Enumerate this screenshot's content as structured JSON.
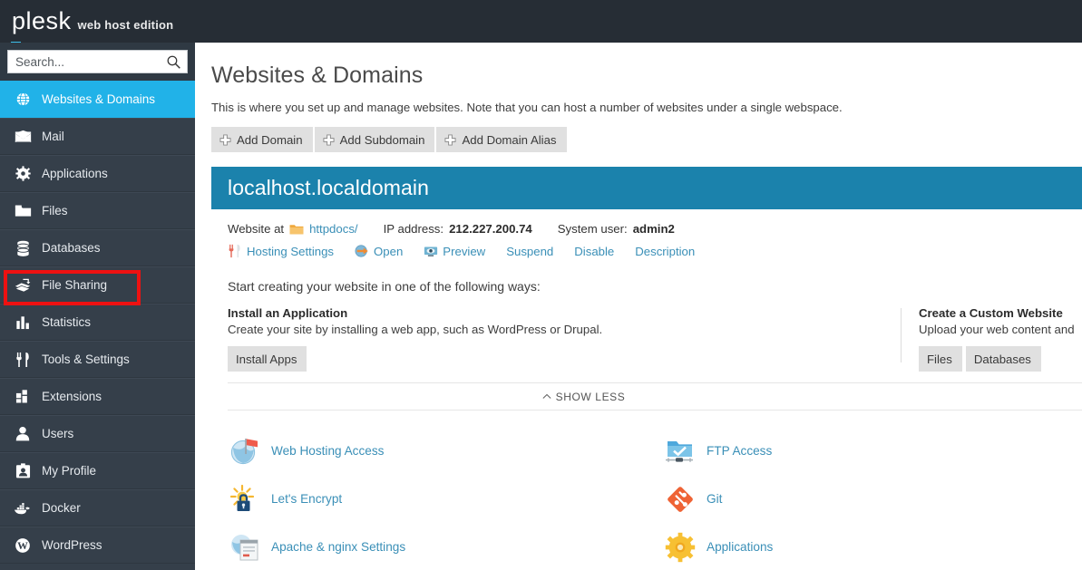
{
  "brand": {
    "name": "plesk",
    "edition": "web host edition"
  },
  "search": {
    "placeholder": "Search...",
    "value": "",
    "icon": "search-icon"
  },
  "sidebar": {
    "items": [
      {
        "label": "Websites & Domains",
        "icon": "globe-icon",
        "active": true
      },
      {
        "label": "Mail",
        "icon": "envelope-icon",
        "active": false
      },
      {
        "label": "Applications",
        "icon": "gear-icon",
        "active": false
      },
      {
        "label": "Files",
        "icon": "folder-icon",
        "active": false
      },
      {
        "label": "Databases",
        "icon": "database-icon",
        "active": false
      },
      {
        "label": "File Sharing",
        "icon": "file-sharing-icon",
        "active": false,
        "highlighted": true
      },
      {
        "label": "Statistics",
        "icon": "bar-chart-icon",
        "active": false
      },
      {
        "label": "Tools & Settings",
        "icon": "fork-knife-icon",
        "active": false
      },
      {
        "label": "Extensions",
        "icon": "blocks-icon",
        "active": false
      },
      {
        "label": "Users",
        "icon": "user-icon",
        "active": false
      },
      {
        "label": "My Profile",
        "icon": "id-card-icon",
        "active": false
      },
      {
        "label": "Docker",
        "icon": "docker-whale-icon",
        "active": false
      },
      {
        "label": "WordPress",
        "icon": "wordpress-icon",
        "active": false
      }
    ]
  },
  "main": {
    "title": "Websites & Domains",
    "description": "This is where you set up and manage websites. Note that you can host a number of websites under a single webspace.",
    "buttons": [
      {
        "label": "Add Domain",
        "icon": "plus-icon"
      },
      {
        "label": "Add Subdomain",
        "icon": "plus-icon"
      },
      {
        "label": "Add Domain Alias",
        "icon": "plus-icon"
      }
    ]
  },
  "domain": {
    "name": "localhost.localdomain",
    "website_at_label": "Website at",
    "docroot": "httpdocs/",
    "ip_label": "IP address:",
    "ip_value": "212.227.200.74",
    "user_label": "System user:",
    "user_value": "admin2",
    "actions": [
      {
        "label": "Hosting Settings",
        "icon": "fork-knife-icon"
      },
      {
        "label": "Open",
        "icon": "open-arrow-icon"
      },
      {
        "label": "Preview",
        "icon": "preview-eye-icon"
      },
      {
        "label": "Suspend",
        "icon": ""
      },
      {
        "label": "Disable",
        "icon": ""
      },
      {
        "label": "Description",
        "icon": ""
      }
    ],
    "start_text": "Start creating your website in one of the following ways:",
    "install": {
      "heading": "Install an Application",
      "text": "Create your site by installing a web app, such as WordPress or Drupal.",
      "button": "Install Apps"
    },
    "custom": {
      "heading": "Create a Custom Website",
      "text": "Upload your web content and",
      "buttons": [
        "Files",
        "Databases"
      ]
    },
    "show_less": "SHOW LESS",
    "tiles_left": [
      {
        "label": "Web Hosting Access",
        "icon": "web-hosting-access-icon"
      },
      {
        "label": "Let's Encrypt",
        "icon": "lets-encrypt-icon"
      },
      {
        "label": "Apache & nginx Settings",
        "icon": "apache-nginx-icon"
      }
    ],
    "tiles_right": [
      {
        "label": "FTP Access",
        "icon": "ftp-access-icon"
      },
      {
        "label": "Git",
        "icon": "git-icon"
      },
      {
        "label": "Applications",
        "icon": "applications-gear-icon"
      }
    ]
  },
  "colors": {
    "topbar": "#262d35",
    "sidebar": "#353f4a",
    "sidebar_active": "#21b2e8",
    "domain_header": "#1b82ac",
    "link": "#3a8fb7",
    "highlight": "#ee1111"
  }
}
